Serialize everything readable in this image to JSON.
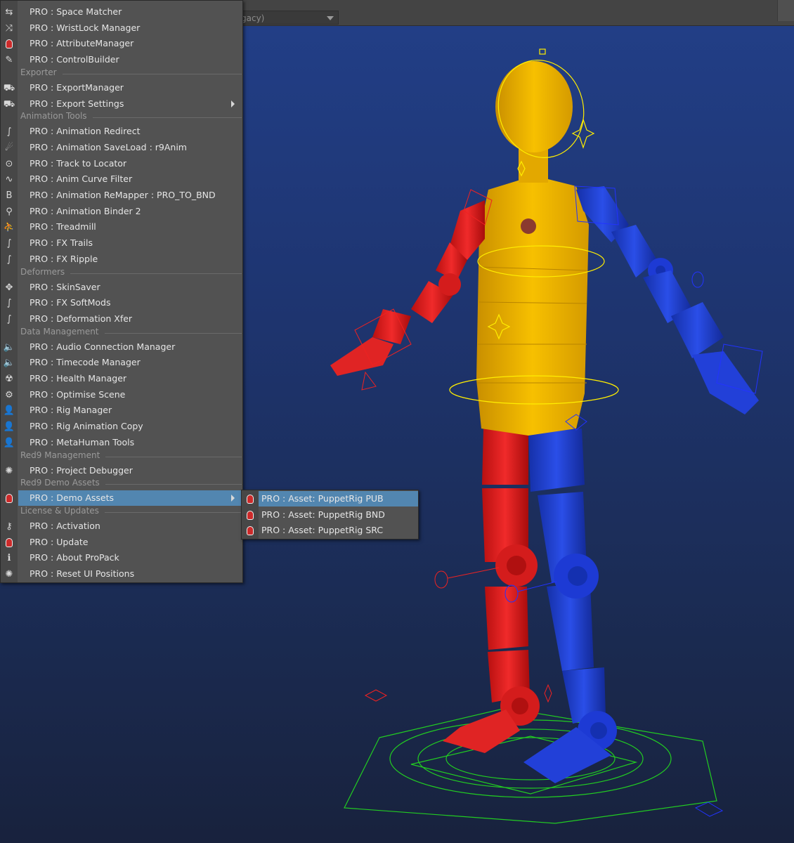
{
  "toolbar": {
    "dropdown_value": "gacy)"
  },
  "menu": {
    "groups": [
      {
        "type": "item",
        "label": "PRO : Space Matcher",
        "icon": "space-matcher-icon"
      },
      {
        "type": "item",
        "label": "PRO : WristLock Manager",
        "icon": "shuffle-icon"
      },
      {
        "type": "item",
        "label": "PRO : AttributeManager",
        "icon": "red9-icon"
      },
      {
        "type": "item",
        "label": "PRO : ControlBuilder",
        "icon": "control-builder-icon"
      },
      {
        "type": "section",
        "label": "Exporter"
      },
      {
        "type": "item",
        "label": "PRO : ExportManager",
        "icon": "export-truck-icon"
      },
      {
        "type": "item",
        "label": "PRO : Export Settings",
        "icon": "export-truck-icon",
        "submenu": true
      },
      {
        "type": "section",
        "label": "Animation Tools"
      },
      {
        "type": "item",
        "label": "PRO : Animation Redirect",
        "icon": "curve-arrows-icon"
      },
      {
        "type": "item",
        "label": "PRO : Animation SaveLoad : r9Anim",
        "icon": "runner-icon"
      },
      {
        "type": "item",
        "label": "PRO : Track to Locator",
        "icon": "target-icon"
      },
      {
        "type": "item",
        "label": "PRO : Anim Curve Filter",
        "icon": "curve-filter-icon"
      },
      {
        "type": "item",
        "label": "PRO : Animation ReMapper : PRO_TO_BND",
        "icon": "bnd-icon"
      },
      {
        "type": "item",
        "label": "PRO : Animation Binder 2",
        "icon": "binder-icon"
      },
      {
        "type": "item",
        "label": "PRO : Treadmill",
        "icon": "treadmill-icon"
      },
      {
        "type": "item",
        "label": "PRO : FX Trails",
        "icon": "curve-arrows-icon"
      },
      {
        "type": "item",
        "label": "PRO : FX Ripple",
        "icon": "curve-arrows-icon"
      },
      {
        "type": "section",
        "label": "Deformers"
      },
      {
        "type": "item",
        "label": "PRO : SkinSaver",
        "icon": "skin-saver-icon"
      },
      {
        "type": "item",
        "label": "PRO : FX SoftMods",
        "icon": "curve-arrows-icon"
      },
      {
        "type": "item",
        "label": "PRO : Deformation Xfer",
        "icon": "curve-arrows-icon"
      },
      {
        "type": "section",
        "label": "Data Management"
      },
      {
        "type": "item",
        "label": "PRO : Audio Connection Manager",
        "icon": "speaker-icon"
      },
      {
        "type": "item",
        "label": "PRO : Timecode Manager",
        "icon": "speaker-icon"
      },
      {
        "type": "item",
        "label": "PRO : Health Manager",
        "icon": "radiation-icon"
      },
      {
        "type": "item",
        "label": "PRO : Optimise Scene",
        "icon": "gear-icon"
      },
      {
        "type": "item",
        "label": "PRO : Rig Manager",
        "icon": "user-icon"
      },
      {
        "type": "item",
        "label": "PRO : Rig Animation Copy",
        "icon": "user-icon"
      },
      {
        "type": "item",
        "label": "PRO : MetaHuman Tools",
        "icon": "user-icon"
      },
      {
        "type": "section",
        "label": "Red9 Management"
      },
      {
        "type": "item",
        "label": "PRO : Project Debugger",
        "icon": "bug-icon"
      },
      {
        "type": "section",
        "label": "Red9 Demo Assets"
      },
      {
        "type": "item",
        "label": "PRO : Demo Assets",
        "icon": "red9-icon",
        "submenu": true,
        "highlighted": true
      },
      {
        "type": "section",
        "label": "License & Updates"
      },
      {
        "type": "item",
        "label": "PRO : Activation",
        "icon": "key-icon"
      },
      {
        "type": "item",
        "label": "PRO : Update",
        "icon": "red9-icon"
      },
      {
        "type": "item",
        "label": "PRO : About ProPack",
        "icon": "info-icon"
      },
      {
        "type": "item",
        "label": "PRO : Reset UI Positions",
        "icon": "bug-icon"
      }
    ]
  },
  "submenu": {
    "items": [
      {
        "label": "PRO : Asset: PuppetRig PUB",
        "icon": "red9-icon",
        "highlighted": true
      },
      {
        "label": "PRO : Asset: PuppetRig BND",
        "icon": "red9-icon"
      },
      {
        "label": "PRO : Asset: PuppetRig SRC",
        "icon": "red9-icon"
      }
    ]
  },
  "colors": {
    "menu_bg": "#525252",
    "highlight": "#5286b0",
    "viewport_top": "#223f88",
    "viewport_bottom": "#18223d",
    "rig_yellow": "#f2b200",
    "rig_red": "#e02020",
    "rig_blue": "#1f3fd0"
  }
}
